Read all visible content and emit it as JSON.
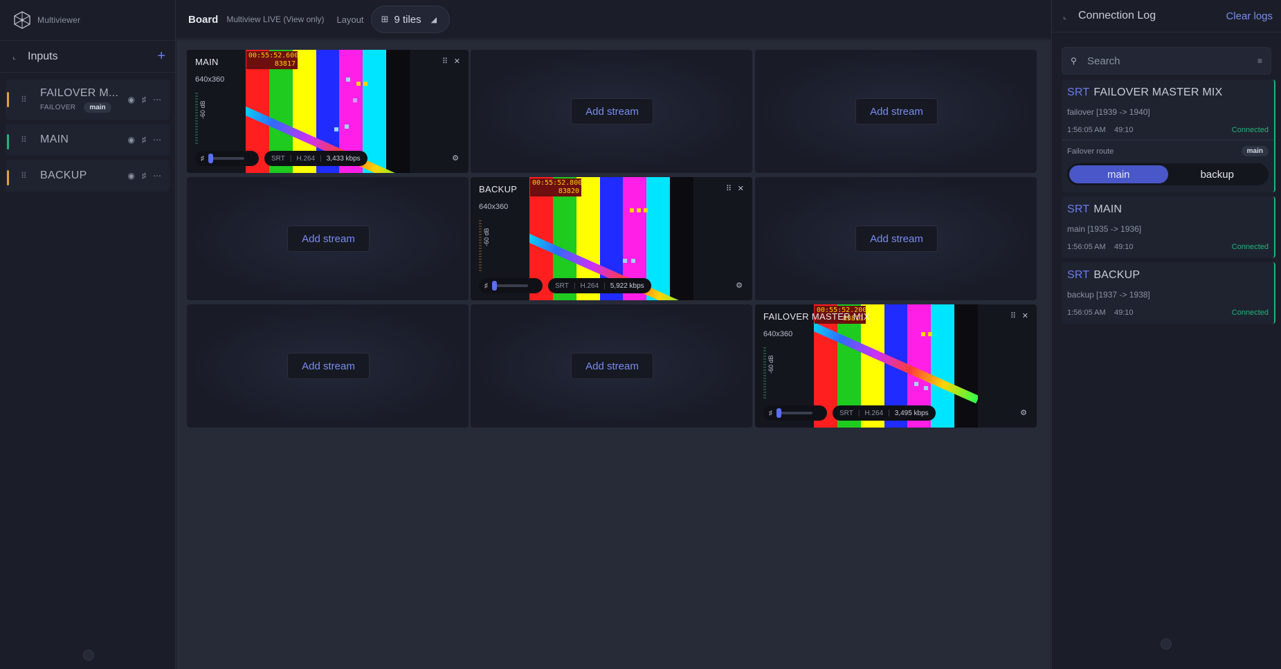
{
  "app": {
    "name": "Multiviewer"
  },
  "sidebar": {
    "title": "Inputs",
    "add_icon": "+",
    "items": [
      {
        "label": "FAILOVER M...",
        "kind": "FAILOVER",
        "badge": "main",
        "color": "#e0a23a"
      },
      {
        "label": "MAIN",
        "color": "#1fb57a"
      },
      {
        "label": "BACKUP",
        "color": "#e0a23a"
      }
    ]
  },
  "topbar": {
    "board": "Board",
    "mode": "Multiview LIVE (View only)",
    "layout_label": "Layout",
    "tiles": "9 tiles"
  },
  "tiles": {
    "add_label": "Add stream",
    "main": {
      "name": "MAIN",
      "res": "640x360",
      "db": "-60 dB",
      "tc_time": "00:55:52.600",
      "tc_frame": "83817",
      "proto": "SRT",
      "codec": "H.264",
      "kbps": "3,433 kbps"
    },
    "backup": {
      "name": "BACKUP",
      "res": "640x360",
      "db": "-60 dB",
      "tc_time": "00:55:52.800",
      "tc_frame": "83820",
      "proto": "SRT",
      "codec": "H.264",
      "kbps": "5,922 kbps"
    },
    "failover": {
      "name": "FAILOVER MASTER MIX",
      "res": "640x360",
      "db": "-60 dB",
      "tc_time": "00:55:52.200",
      "tc_frame": "83811",
      "proto": "SRT",
      "codec": "H.264",
      "kbps": "3,495 kbps"
    }
  },
  "log": {
    "title": "Connection Log",
    "clear": "Clear logs",
    "search_placeholder": "Search",
    "entries": [
      {
        "proto": "SRT",
        "name": "FAILOVER MASTER MIX",
        "route": "failover [1939 -> 1940]",
        "time": "1:56:05 AM",
        "dur": "49:10",
        "status": "Connected",
        "fo_label": "Failover route",
        "fo_badge": "main",
        "seg_a": "main",
        "seg_b": "backup"
      },
      {
        "proto": "SRT",
        "name": "MAIN",
        "route": "main [1935 -> 1936]",
        "time": "1:56:05 AM",
        "dur": "49:10",
        "status": "Connected"
      },
      {
        "proto": "SRT",
        "name": "BACKUP",
        "route": "backup [1937 -> 1938]",
        "time": "1:56:05 AM",
        "dur": "49:10",
        "status": "Connected"
      }
    ]
  },
  "colors": {
    "accent": "#6c7cf0",
    "connected": "#1fb57a",
    "warning": "#e0a23a"
  }
}
